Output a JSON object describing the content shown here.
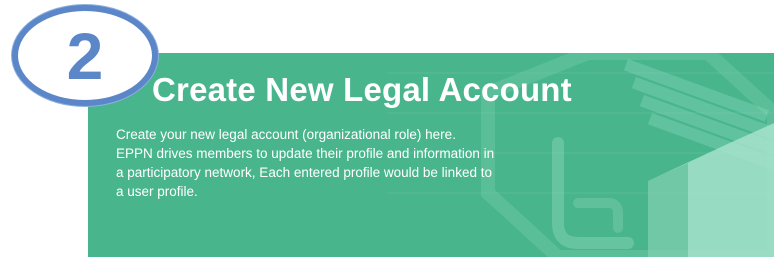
{
  "banner": {
    "title": "Create New Legal Account",
    "description": "Create your new legal account (organizational role) here. EPPN drives members to update their profile and information in a participatory network, Each entered profile would be linked to a user profile."
  },
  "step_badge": {
    "number": "2"
  },
  "colors": {
    "banner_background": "#48b58d",
    "badge_ring": "#5b86c8",
    "banner_text": "#ffffff"
  }
}
